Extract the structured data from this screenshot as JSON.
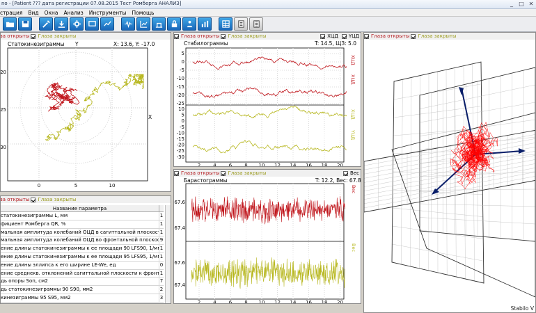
{
  "window": {
    "title": "no - [Patient   ??? дата регистрации 07.08.2015 Тест Ромберга АНАЛИЗ]",
    "min": "_",
    "max": "□",
    "close": "✕"
  },
  "menu": [
    "страция",
    "Вид",
    "Окна",
    "Анализ",
    "Инструменты",
    "Помощь"
  ],
  "toolbar": {
    "buttons": [
      "folder-icon",
      "save-icon",
      "tools-icon",
      "download-icon",
      "settings-icon",
      "monitor-icon",
      "chart-icon",
      "pulse-icon",
      "statistics-icon",
      "scale-icon",
      "lock-icon",
      "patient-icon",
      "bars-icon",
      "table-icon",
      "document-icon",
      "list-icon"
    ]
  },
  "legend": {
    "eyes_open": "Глаза открыты",
    "eyes_closed": "Глаза закрыты"
  },
  "statokinesigram": {
    "title": "Статокинезиграммы",
    "y_label": "Y",
    "x_label": "X",
    "coords": "X: 13.6, Y: -17.0",
    "y_ticks": [
      "-20",
      "-25",
      "-30"
    ],
    "x_ticks": [
      "0",
      "5",
      "10"
    ],
    "x_range": [
      -4,
      13
    ],
    "y_range": [
      -34,
      -16
    ]
  },
  "stabilogram": {
    "title": "Стабилограммы",
    "values": "T: 14.5, ЩЗ: 5.0",
    "chk_x": "ХЦД",
    "chk_y": "YЦД",
    "upper_ticks": [
      "5",
      "0",
      "-5",
      "-10",
      "-15",
      "-20",
      "-25"
    ],
    "lower_ticks": [
      "10",
      "5",
      "0",
      "-5",
      "-10",
      "-15",
      "-20",
      "-25",
      "-30"
    ],
    "side_labels": [
      "ХЦД",
      "ХЦД",
      "ХЦД",
      "YЦД"
    ],
    "x_ticks": [
      "2",
      "4",
      "6",
      "8",
      "10",
      "12",
      "14",
      "16",
      "18",
      "20"
    ]
  },
  "barostabilogram": {
    "title": "Барастограммы",
    "values": "T: 12.2, Вес: 67.8",
    "chk_weight": "Вес",
    "upper_ticks": [
      "67.6",
      "67.4"
    ],
    "lower_ticks": [
      "67.6",
      "67.4"
    ],
    "side_labels": [
      "Вес",
      "Вес"
    ],
    "x_ticks": [
      "2",
      "4",
      "6",
      "8",
      "10",
      "12",
      "14",
      "16",
      "18",
      "20"
    ]
  },
  "params_table": {
    "header": "Название параметра",
    "rows": [
      {
        "name": "статокинезиграммы L, мм",
        "val": "1"
      },
      {
        "name": "фициент Ромберга QR, %",
        "val": "1"
      },
      {
        "name": "мальная амплитуда колебаний ОЦД в сагиттальной плоскости Ay, мм",
        "val": "1"
      },
      {
        "name": "мальная амплитуда колебаний ОЦД во фронтальной плоскости Ax, мм",
        "val": "9"
      },
      {
        "name": "ение длины статокинезиграммы к ее площади 90 LFS90, 1/мм",
        "val": "1"
      },
      {
        "name": "ение длины статокинезиграммы к ее площади 95 LFS95, 1/мм",
        "val": "1"
      },
      {
        "name": "ение длины эллипса к его ширине LE-We, ед",
        "val": "0"
      },
      {
        "name": "ение среднекв. отклонений сагиттальной плоскости к фронтальной y/x, ед",
        "val": "1"
      },
      {
        "name": "дь опоры Sоп, см2",
        "val": "7"
      },
      {
        "name": "дь статокинезиграммы 90 S90, мм2",
        "val": "2"
      },
      {
        "name": "кинезиграммы 95 S95, мм2",
        "val": "3"
      }
    ]
  },
  "view3d": {
    "label": "Stabilo V"
  },
  "colors": {
    "red": "#c0161c",
    "yellow": "#b7b71e",
    "navy": "#0a1f6a"
  }
}
